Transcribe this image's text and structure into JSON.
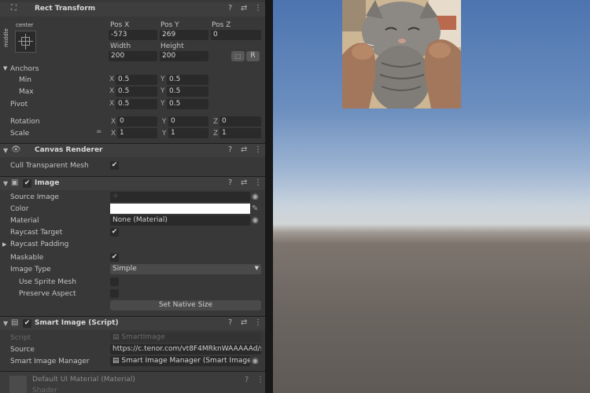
{
  "rect_transform": {
    "title": "Rect Transform",
    "anchor_preset_top": "center",
    "anchor_preset_side": "middle",
    "pos_x_label": "Pos X",
    "pos_y_label": "Pos Y",
    "pos_z_label": "Pos Z",
    "pos_x": "-573",
    "pos_y": "269",
    "pos_z": "0",
    "width_label": "Width",
    "height_label": "Height",
    "width": "200",
    "height": "200",
    "blueprint_btn": "⬚",
    "raw_btn": "R",
    "anchors_label": "Anchors",
    "min_label": "Min",
    "max_label": "Max",
    "pivot_label": "Pivot",
    "min_x": "0.5",
    "min_y": "0.5",
    "max_x": "0.5",
    "max_y": "0.5",
    "pivot_x": "0.5",
    "pivot_y": "0.5",
    "rotation_label": "Rotation",
    "scale_label": "Scale",
    "rot_x": "0",
    "rot_y": "0",
    "rot_z": "0",
    "scale_x": "1",
    "scale_y": "1",
    "scale_z": "1",
    "axis_x": "X",
    "axis_y": "Y",
    "axis_z": "Z"
  },
  "canvas_renderer": {
    "title": "Canvas Renderer",
    "cull_label": "Cull Transparent Mesh",
    "cull_checked": "✔"
  },
  "image": {
    "title": "Image",
    "enabled": "✔",
    "source_image_label": "Source Image",
    "source_image_value": "",
    "color_label": "Color",
    "color_value": "#ffffff",
    "material_label": "Material",
    "material_value": "None (Material)",
    "raycast_target_label": "Raycast Target",
    "raycast_target_checked": "✔",
    "raycast_padding_label": "Raycast Padding",
    "maskable_label": "Maskable",
    "maskable_checked": "✔",
    "image_type_label": "Image Type",
    "image_type_value": "Simple",
    "use_sprite_mesh_label": "Use Sprite Mesh",
    "preserve_aspect_label": "Preserve Aspect",
    "set_native_size_label": "Set Native Size"
  },
  "smart_image": {
    "title": "Smart Image (Script)",
    "enabled": "✔",
    "script_label": "Script",
    "script_value": "SmartImage",
    "source_label": "Source",
    "source_value": "https://c.tenor.com/vt8F4MRknWAAAAAd/sr",
    "manager_label": "Smart Image Manager",
    "manager_value": "Smart Image Manager (Smart Image Ma"
  },
  "material_footer": {
    "title": "Default UI Material (Material)",
    "shader_label": "Shader"
  },
  "colors": {
    "panel_bg": "#383838",
    "field_bg": "#2a2a2a",
    "header_bg": "#3e3e3e",
    "sky_top": "#4d74b0",
    "ground": "#6b6560"
  }
}
